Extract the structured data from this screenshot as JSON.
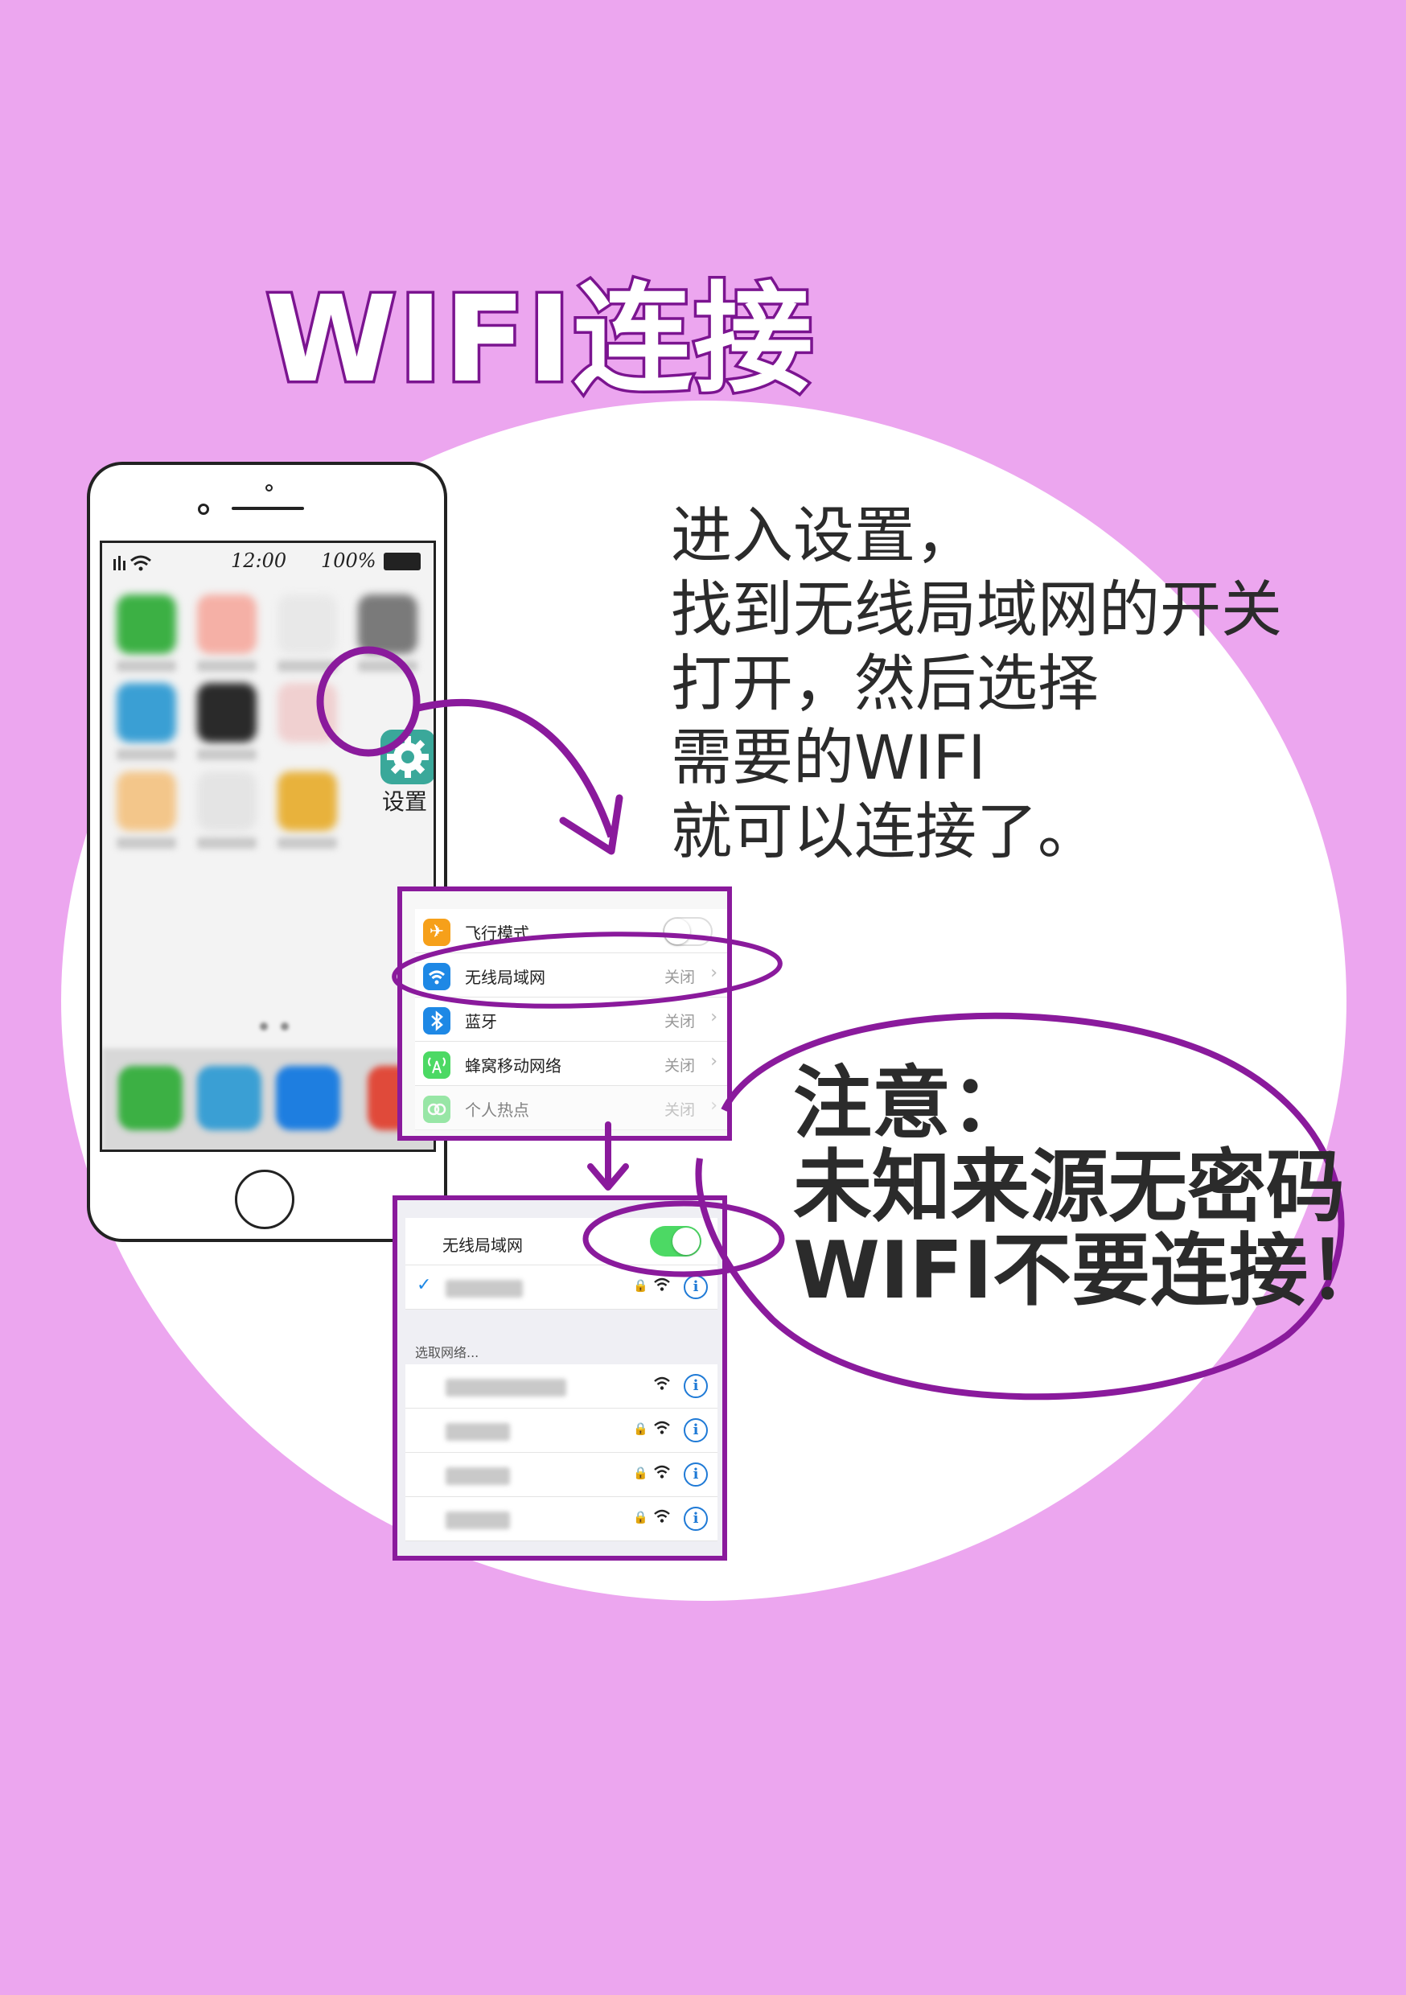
{
  "title": "WIFI连接",
  "instructions": {
    "line1": "进入设置，",
    "line2": "找到无线局域网的开关",
    "line3": "打开，然后选择",
    "line4": "需要的WIFI",
    "line5": "就可以连接了。"
  },
  "phone": {
    "status": {
      "time": "12:00",
      "battery": "100%"
    },
    "settings_app_label": "设置"
  },
  "settings_panel": {
    "rows": [
      {
        "label": "飞行模式",
        "icon": "airplane-icon",
        "color": "#f6a01a",
        "value": ""
      },
      {
        "label": "无线局域网",
        "icon": "wifi-icon",
        "color": "#1e88e5",
        "value": "关闭"
      },
      {
        "label": "蓝牙",
        "icon": "bluetooth-icon",
        "color": "#1e88e5",
        "value": "关闭"
      },
      {
        "label": "蜂窝移动网络",
        "icon": "cellular-icon",
        "color": "#4cd964",
        "value": "关闭"
      },
      {
        "label": "个人热点",
        "icon": "hotspot-icon",
        "color": "#a8e6a8",
        "value": "关闭"
      }
    ]
  },
  "wifi_panel": {
    "header_label": "无线局域网",
    "choose_network_label": "选取网络..."
  },
  "warning": {
    "line1": "注意：",
    "line2": "未知来源无密码",
    "line3": "WIFI不要连接！"
  },
  "colors": {
    "background": "#eca6ef",
    "accent_purple": "#8a1a9c",
    "toggle_green": "#4cd964",
    "info_blue": "#1f7ad6"
  }
}
